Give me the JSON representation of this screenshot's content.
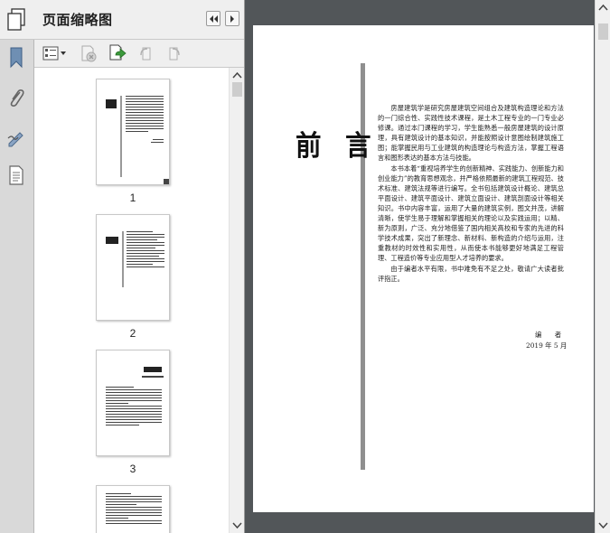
{
  "sidebar": {
    "title": "页面缩略图",
    "rail_icons": [
      "pages-icon",
      "bookmark-icon",
      "attachment-icon",
      "signature-icon",
      "content-icon"
    ]
  },
  "thumbnails": [
    {
      "label": "1"
    },
    {
      "label": "2"
    },
    {
      "label": "3"
    }
  ],
  "document": {
    "heading": "前 言",
    "paragraphs": [
      "房屋建筑学是研究房屋建筑空间组合及建筑构造理论和方法的一门综合性、实践性技术课程，是土木工程专业的一门专业必修课。通过本门课程的学习，学生能熟悉一般房屋建筑的设计原理，具有建筑设计的基本知识，并能按照设计意图绘制建筑施工图；能掌握民用与工业建筑的构造理论与构造方法，掌握工程语言和图形表达的基本方法与技能。",
      "本书本着“重视培养学生的创新精神、实践能力、创新能力和创业能力”的教育思想观念，并严格依照最新的建筑工程规范、技术标准、建筑法规等进行编写。全书包括建筑设计概论、建筑总平面设计、建筑平面设计、建筑立面设计、建筑剖面设计等相关知识。书中内容丰富，运用了大量的建筑实例，图文并茂，讲解清晰，使学生易于理解和掌握相关的理论以及实践运用；以精、新为原则，广泛、充分地借鉴了国内相关高校和专家的先进的科学技术成果，突出了新理念、新材料、新构造的介绍与运用，注重教材的时效性和实用性，从而使本书能够更好地满足工程管理、工程造价等专业应用型人才培养的要求。",
      "由于编者水平有限，书中难免有不足之处，敬请广大读者批评指正。"
    ],
    "signature": "编 者",
    "date": "2019 年 5 月"
  }
}
